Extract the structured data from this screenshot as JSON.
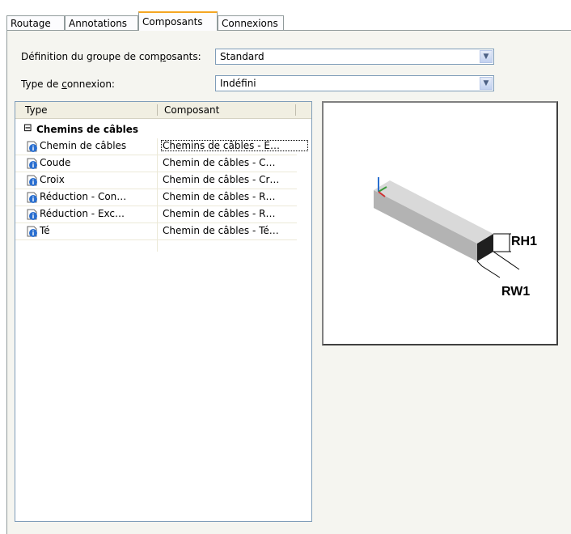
{
  "tabs": [
    {
      "label": "Routage"
    },
    {
      "label": "Annotations"
    },
    {
      "label": "Composants",
      "active": true
    },
    {
      "label": "Connexions"
    }
  ],
  "group_definition": {
    "label_pre": "Définition du groupe de com",
    "label_u": "p",
    "label_post": "osants:",
    "value": "Standard"
  },
  "connection_type": {
    "label_pre": "Type de ",
    "label_u": "c",
    "label_post": "onnexion:",
    "value": "Indéfini"
  },
  "grid": {
    "columns": [
      "Type",
      "Composant"
    ],
    "group": {
      "toggle": "⊟",
      "label": "Chemins de câbles"
    },
    "rows": [
      {
        "type": "Chemin de câbles",
        "component": "Chemins de câbles - E…"
      },
      {
        "type": "Coude",
        "component": "Chemin de câbles - C…"
      },
      {
        "type": "Croix",
        "component": "Chemin de câbles - Cr…"
      },
      {
        "type": "Réduction - Con…",
        "component": "Chemin de câbles - R…"
      },
      {
        "type": "Réduction - Exc…",
        "component": "Chemin de câbles - R…"
      },
      {
        "type": "Té",
        "component": "Chemin de câbles - Té…"
      }
    ]
  },
  "preview": {
    "dim_height": "RH1",
    "dim_width": "RW1"
  },
  "colors": {
    "tab_accent": "#f5a623",
    "info_icon": "#2a6fd0"
  }
}
